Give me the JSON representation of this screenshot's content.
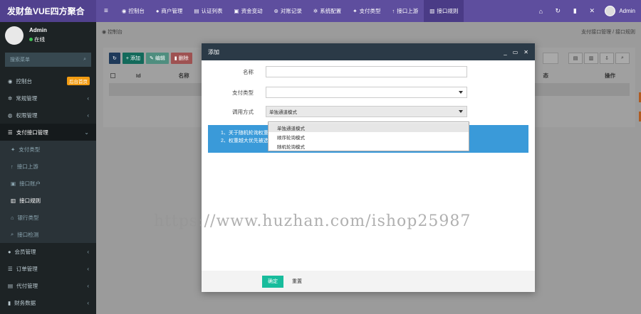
{
  "app": {
    "title": "发财鱼VUE四方聚合"
  },
  "topnav": {
    "items": [
      {
        "label": "控制台",
        "icon": "dashboard-icon"
      },
      {
        "label": "商户管理",
        "icon": "user-icon"
      },
      {
        "label": "认证列表",
        "icon": "list-icon"
      },
      {
        "label": "资金变动",
        "icon": "money-icon"
      },
      {
        "label": "对账记录",
        "icon": "record-icon"
      },
      {
        "label": "系统配置",
        "icon": "gear-icon"
      },
      {
        "label": "支付类型",
        "icon": "pay-icon"
      },
      {
        "label": "接口上游",
        "icon": "arrow-up-icon"
      },
      {
        "label": "接口规则",
        "icon": "rule-icon",
        "active": true
      }
    ],
    "user": "Admin"
  },
  "sidebar": {
    "user": {
      "name": "Admin",
      "status": "在线"
    },
    "search_placeholder": "搜索菜单",
    "items": [
      {
        "label": "控制台",
        "badge": "后台首页"
      },
      {
        "label": "常规管理"
      },
      {
        "label": "权限管理"
      },
      {
        "label": "支付接口管理",
        "open": true
      }
    ],
    "sub_items": [
      {
        "label": "支付类型"
      },
      {
        "label": "接口上游"
      },
      {
        "label": "接口账户"
      },
      {
        "label": "接口规则",
        "current": true
      },
      {
        "label": "银行类型"
      },
      {
        "label": "接口检测"
      }
    ],
    "items_after": [
      {
        "label": "会员管理"
      },
      {
        "label": "订单管理"
      },
      {
        "label": "代付管理"
      },
      {
        "label": "财务数据"
      }
    ]
  },
  "breadcrumb": {
    "left": "控制台",
    "right": "支付接口管理 / 接口规则"
  },
  "toolbar": {
    "add": "添加",
    "edit": "编辑",
    "delete": "删除"
  },
  "table": {
    "col_id": "Id",
    "col_name": "名称",
    "col_status": "态",
    "col_ops": "操作"
  },
  "modal": {
    "title": "添加",
    "fields": {
      "name_label": "名称",
      "name_value": "",
      "paytype_label": "支付类型",
      "paytype_value": "",
      "mode_label": "调用方式",
      "mode_value": "单独通道模式"
    },
    "dropdown_options": [
      "单独通道模式",
      "顺序轮询模式",
      "随机轮询模式"
    ],
    "notice": [
      "1、关于随机轮询权重设置：请在通道列表中设置",
      "2、权重越大优先被选中的概率越高"
    ],
    "confirm": "确定",
    "reset": "重置"
  },
  "watermark": "https://www.huzhan.com/ishop25987"
}
